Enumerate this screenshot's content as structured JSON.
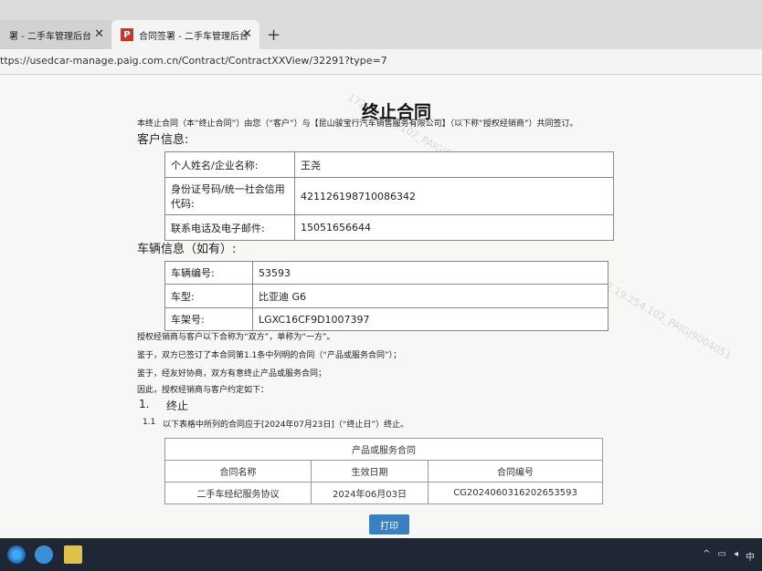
{
  "browser": {
    "tabs": [
      {
        "title": "署 - 二手车管理后台",
        "close": "✕"
      },
      {
        "title": "合同签署 - 二手车管理后台",
        "close": "✕",
        "favicon": "P"
      }
    ],
    "new_tab": "+",
    "url": "ttps://usedcar-manage.paig.com.cn/Contract/ContractXXView/32291?type=7",
    "tool_icons": [
      "read-aloud-icon",
      "favorite-star-icon",
      "split-screen-icon",
      "favorites-list-icon"
    ]
  },
  "document": {
    "title": "终止合同",
    "intro": "本终止合同（本“终止合同”）由您（“客户”）与【昆山骏宝行汽车销售服务有限公司】（以下称“授权经销商”）共同签订。",
    "customer_heading": "客户信息:",
    "customer_rows": [
      {
        "label": "个人姓名/企业名称:",
        "value": "王尧"
      },
      {
        "label": "身份证号码/统一社会信用代码:",
        "value": "421126198710086342"
      },
      {
        "label": "联系电话及电子邮件:",
        "value": "15051656644"
      }
    ],
    "vehicle_heading": "车辆信息（如有）:",
    "vehicle_rows": [
      {
        "label": "车辆编号:",
        "value": "53593"
      },
      {
        "label": "车型:",
        "value": "比亚迪 G6"
      },
      {
        "label": "车架号:",
        "value": "LGXC16CF9D1007397"
      }
    ],
    "clauses": [
      "授权经销商与客户以下合称为“双方”，单称为“一方”。",
      "鉴于，双方已签订了本合同第1.1条中列明的合同（“产品或服务合同”）；",
      "鉴于，经友好协商，双方有意终止产品或服务合同；",
      "因此，授权经销商与客户约定如下："
    ],
    "section1_num": "1.",
    "section1_title": "终止",
    "clause_1_1_num": "1.1",
    "clause_1_1_text": "以下表格中所列的合同应于[2024年07月23日]（“终止日”）终止。",
    "product_table": {
      "caption": "产品或服务合同",
      "headers": [
        "合同名称",
        "生效日期",
        "合同编号"
      ],
      "rows": [
        [
          "二手车经纪服务协议",
          "2024年06月03日",
          "CG2024060316202653593"
        ]
      ]
    },
    "print_label": "打印"
  },
  "watermark": "172.19.254.102_PAIG|9004051",
  "colors": {
    "print_button": "#3a7fc1",
    "favicon": "#c0392b"
  }
}
